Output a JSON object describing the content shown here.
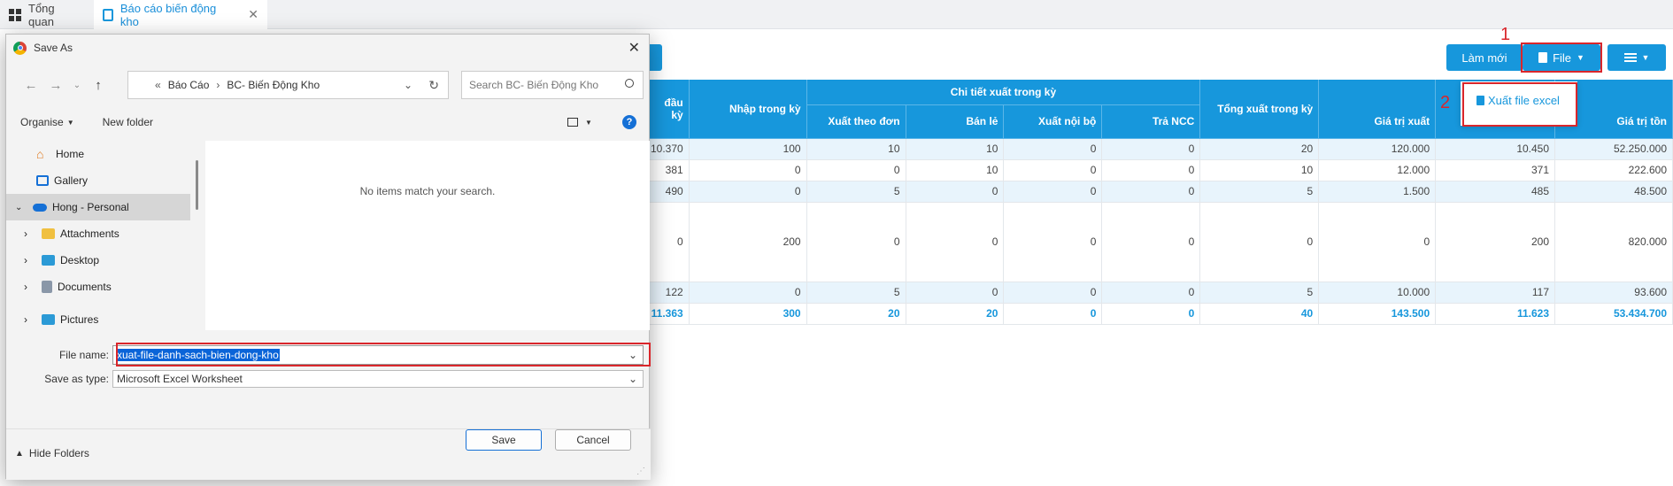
{
  "tabs": [
    {
      "label": "Tổng quan"
    },
    {
      "label": "Báo cáo biến động kho"
    }
  ],
  "toolbar": {
    "refresh_label": "Làm mới",
    "file_label": "File"
  },
  "dropdown": {
    "export_label": "Xuất file excel"
  },
  "annotations": {
    "step1": "1",
    "step2": "2"
  },
  "table": {
    "group_header": "Chi tiết xuất trong kỳ",
    "columns": [
      "đầu kỳ",
      "Nhập trong kỳ",
      "Xuất theo đơn",
      "Bán lẻ",
      "Xuất nội bộ",
      "Trả NCC",
      "Tổng xuất trong kỳ",
      "Giá trị xuất",
      "",
      "Giá trị tồn"
    ],
    "rows": [
      [
        "10.370",
        "100",
        "10",
        "10",
        "0",
        "0",
        "20",
        "120.000",
        "10.450",
        "52.250.000"
      ],
      [
        "381",
        "0",
        "0",
        "10",
        "0",
        "0",
        "10",
        "12.000",
        "371",
        "222.600"
      ],
      [
        "490",
        "0",
        "5",
        "0",
        "0",
        "0",
        "5",
        "1.500",
        "485",
        "48.500"
      ],
      [
        "0",
        "200",
        "0",
        "0",
        "0",
        "0",
        "0",
        "0",
        "200",
        "820.000"
      ],
      [
        "122",
        "0",
        "5",
        "0",
        "0",
        "0",
        "5",
        "10.000",
        "117",
        "93.600"
      ]
    ],
    "totals": [
      "11.363",
      "300",
      "20",
      "20",
      "0",
      "0",
      "40",
      "143.500",
      "11.623",
      "53.434.700"
    ]
  },
  "dialog": {
    "title": "Save As",
    "breadcrumb": [
      "Báo Cáo",
      "BC- Biến Động Kho"
    ],
    "search_placeholder": "Search BC- Biến Động Kho",
    "organise_label": "Organise",
    "new_folder_label": "New folder",
    "empty_message": "No items match your search.",
    "sidebar": [
      "Home",
      "Gallery",
      "Hong - Personal",
      "Attachments",
      "Desktop",
      "Documents",
      "Pictures"
    ],
    "file_name_label": "File name:",
    "file_name_value": "xuat-file-danh-sach-bien-dong-kho",
    "save_type_label": "Save as type:",
    "save_type_value": "Microsoft Excel Worksheet",
    "hide_folders_label": "Hide Folders",
    "save_label": "Save",
    "cancel_label": "Cancel"
  },
  "colors": {
    "accent": "#1797dc",
    "highlight": "#d9262b",
    "selection": "#0a64d8"
  }
}
